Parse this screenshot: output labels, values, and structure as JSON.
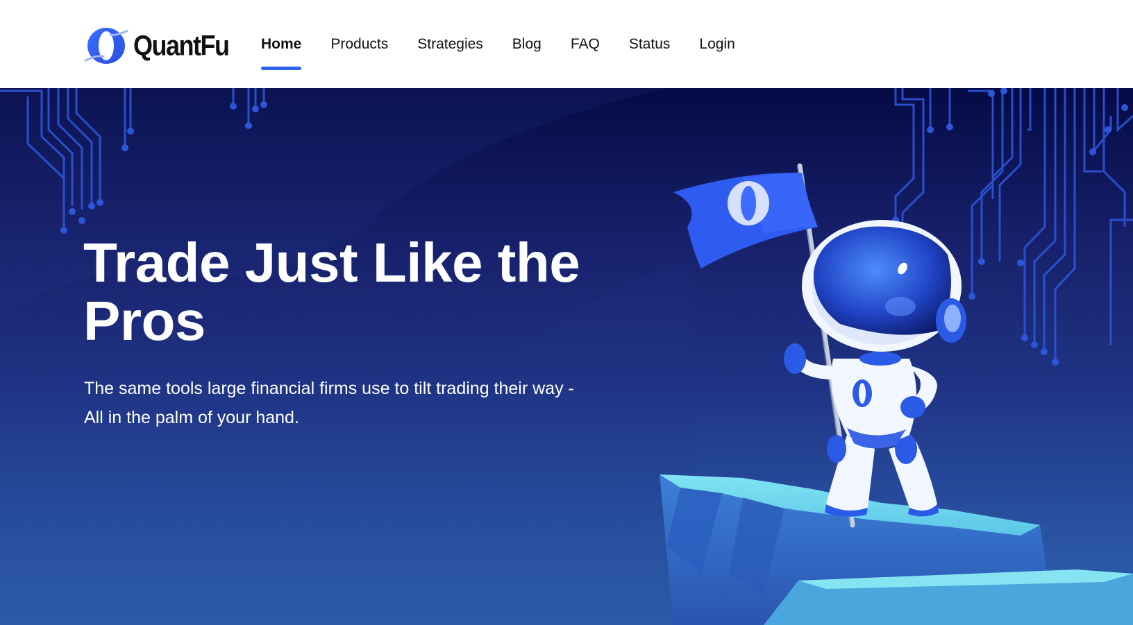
{
  "brand": {
    "name": "QuantFu",
    "logo_icon": "quantfu-logo-icon",
    "accent_color": "#2f61f0"
  },
  "nav": {
    "items": [
      {
        "label": "Home",
        "active": true
      },
      {
        "label": "Products",
        "active": false
      },
      {
        "label": "Strategies",
        "active": false
      },
      {
        "label": "Blog",
        "active": false
      },
      {
        "label": "FAQ",
        "active": false
      },
      {
        "label": "Status",
        "active": false
      },
      {
        "label": "Login",
        "active": false
      }
    ]
  },
  "hero": {
    "title": "Trade Just Like the Pros",
    "subtitle_line1": "The same tools large financial firms use to tilt trading their way -",
    "subtitle_line2": "All in the palm of your hand.",
    "illustration": "astronaut-robot-with-flag-illustration",
    "background_colors": [
      "#050b45",
      "#1f3384",
      "#2d60ad"
    ]
  }
}
